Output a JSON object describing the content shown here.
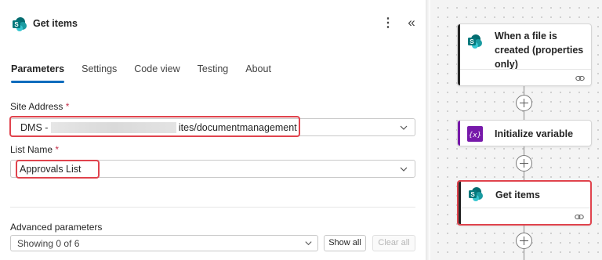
{
  "panel": {
    "title": "Get items",
    "more_icon": "more-vertical-icon",
    "collapse_icon": "double-chevron-left-icon",
    "tabs": [
      "Parameters",
      "Settings",
      "Code view",
      "Testing",
      "About"
    ],
    "active_tab": "Parameters",
    "site_address": {
      "label": "Site Address",
      "required_mark": "*",
      "value_prefix": "DMS -",
      "value_suffix": "ites/documentmanagement"
    },
    "list_name": {
      "label": "List Name",
      "required_mark": "*",
      "value": "Approvals List"
    },
    "advanced": {
      "label": "Advanced parameters",
      "dropdown_value": "Showing 0 of 6",
      "show_all": "Show all",
      "clear_all": "Clear all"
    }
  },
  "flow": {
    "cards": [
      {
        "title": "When a file is created (properties only)",
        "icon": "sharepoint-icon",
        "accent": "#242424"
      },
      {
        "title": "Initialize variable",
        "icon": "variable-icon",
        "accent": "#7719aa"
      },
      {
        "title": "Get items",
        "icon": "sharepoint-icon",
        "accent": "#242424"
      }
    ]
  },
  "colors": {
    "accent": "#0f6cbd",
    "highlight": "#e0434d",
    "sharepoint": "#038387",
    "variable": "#7719aa"
  }
}
